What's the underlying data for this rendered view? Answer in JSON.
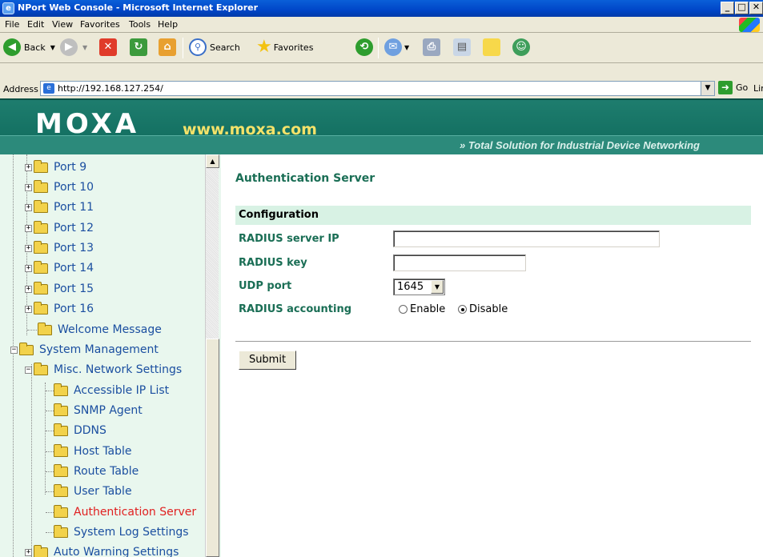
{
  "window": {
    "title": "NPort Web Console - Microsoft Internet Explorer",
    "buttons": [
      "_",
      "□",
      "✕"
    ]
  },
  "menu": [
    "File",
    "Edit",
    "View",
    "Favorites",
    "Tools",
    "Help"
  ],
  "toolbar": {
    "back_label": "Back",
    "search_label": "Search",
    "favorites_label": "Favorites"
  },
  "address": {
    "label": "Address",
    "url": "http://192.168.127.254/",
    "go_label": "Go",
    "links_label": "Links »"
  },
  "banner": {
    "logo": "MOXA",
    "site": "www.moxa.com",
    "tagline": "» Total Solution for Industrial Device Networking"
  },
  "sidebar": {
    "items": [
      {
        "label": "Port 9"
      },
      {
        "label": "Port 10"
      },
      {
        "label": "Port 11"
      },
      {
        "label": "Port 12"
      },
      {
        "label": "Port 13"
      },
      {
        "label": "Port 14"
      },
      {
        "label": "Port 15"
      },
      {
        "label": "Port 16"
      },
      {
        "label": "Welcome Message"
      },
      {
        "label": "System Management"
      },
      {
        "label": "Misc. Network Settings"
      },
      {
        "label": "Accessible IP List"
      },
      {
        "label": "SNMP Agent"
      },
      {
        "label": "DDNS"
      },
      {
        "label": "Host Table"
      },
      {
        "label": "Route Table"
      },
      {
        "label": "User Table"
      },
      {
        "label": "Authentication Server",
        "active": true
      },
      {
        "label": "System Log Settings"
      },
      {
        "label": "Auto Warning Settings"
      }
    ]
  },
  "main": {
    "page_title": "Authentication Server",
    "section": "Configuration",
    "fields": {
      "radius_ip_label": "RADIUS server IP",
      "radius_ip_value": "",
      "radius_key_label": "RADIUS key",
      "radius_key_value": "",
      "udp_port_label": "UDP port",
      "udp_port_value": "1645",
      "accounting_label": "RADIUS accounting",
      "enable_label": "Enable",
      "disable_label": "Disable",
      "accounting_selected": "Disable"
    },
    "submit_label": "Submit"
  }
}
